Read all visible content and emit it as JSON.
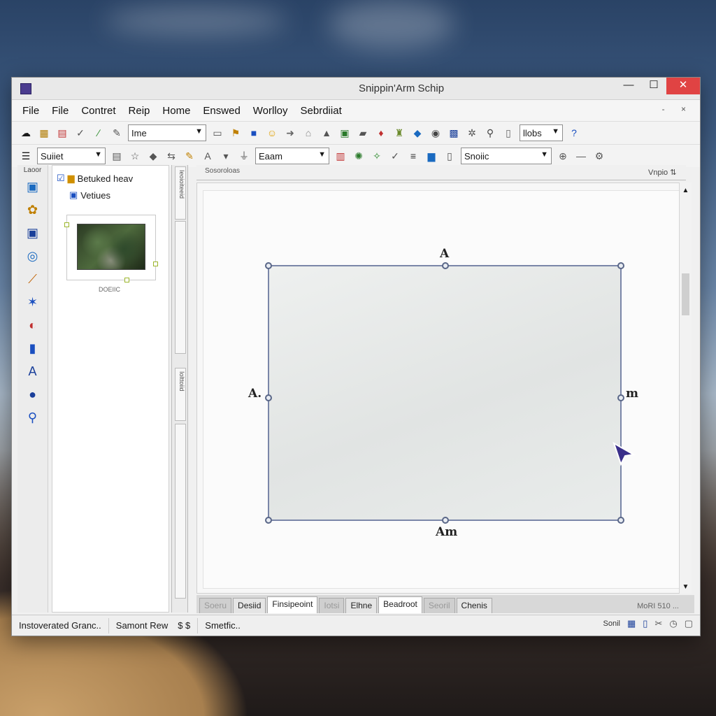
{
  "window": {
    "title": "Snippin'Arm Schip",
    "controls": {
      "minimize": "—",
      "maximize": "☐",
      "close": "✕"
    }
  },
  "menubar": {
    "items": [
      "File",
      "File",
      "Contret",
      "Reip",
      "Home",
      "Enswed",
      "Worlloy",
      "Sebrdiiat"
    ],
    "right_glyphs": "- ×"
  },
  "toolbar1": {
    "font_combo": "Ime",
    "size_combo": "llobs"
  },
  "toolbar2": {
    "style_combo": "Suiiet",
    "font_combo2": "Eaam",
    "snap_combo": "Snoiic"
  },
  "leftbar": {
    "label": "Laoor"
  },
  "navpanel": {
    "tree": [
      {
        "label": "Betuked heav"
      },
      {
        "label": "Vetiues"
      }
    ],
    "thumb_caption": "DOEIIC"
  },
  "hruler": {
    "label": "Sosoroloas",
    "right_label": "Vnpio"
  },
  "vruler": {
    "label_top": "Ieoioiteeid",
    "label_mid": "Iolttoiid"
  },
  "shape": {
    "label_top": "A",
    "label_left": "A.",
    "label_right": "m",
    "label_bottom": "Am"
  },
  "tabs": [
    {
      "label": "Soeru",
      "state": "faded"
    },
    {
      "label": "Desiid",
      "state": "normal"
    },
    {
      "label": "Finsipeoint",
      "state": "active"
    },
    {
      "label": "Iotsi",
      "state": "faded"
    },
    {
      "label": "Elhne",
      "state": "normal"
    },
    {
      "label": "Beadroot",
      "state": "active"
    },
    {
      "label": "Seoril",
      "state": "faded"
    },
    {
      "label": "Chenis",
      "state": "normal"
    }
  ],
  "tab_right": "MoRI 510 ...",
  "statusbar": {
    "left": "Instoverated Granc..",
    "mid": "Samont Rew",
    "mid_icon": "$ $",
    "status": "Smetfic..",
    "right_label": "Sonil"
  },
  "colors": {
    "window_bg": "#f0f0f0",
    "close_red": "#e04343",
    "shape_border": "#7a86a8",
    "handle_border": "#5a6788"
  }
}
